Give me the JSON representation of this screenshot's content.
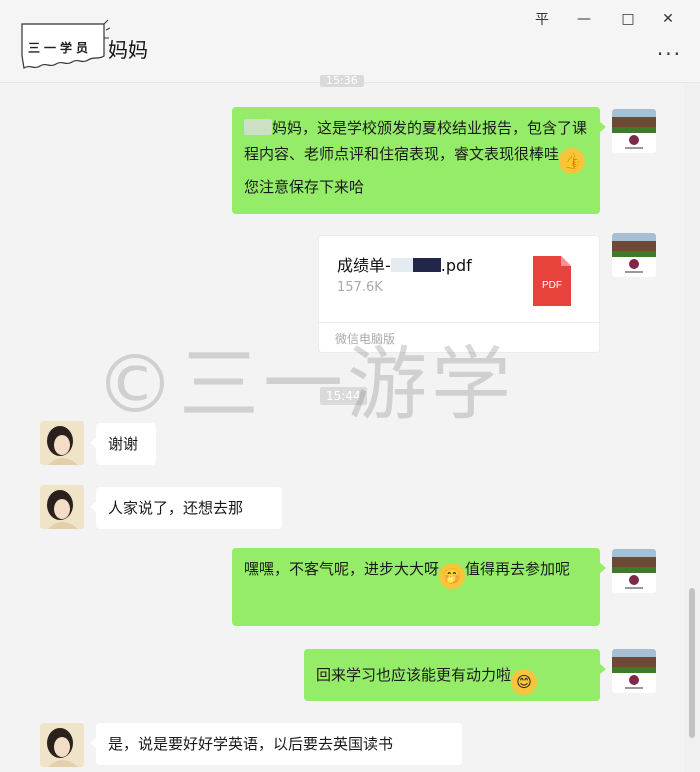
{
  "window": {
    "controls": {
      "pin": "平",
      "minimize": "—",
      "maximize": "□",
      "close": "✕"
    },
    "more": "···"
  },
  "brand": {
    "text": "三一学员"
  },
  "chat": {
    "title": "妈妈"
  },
  "timestamps": {
    "top": "15:36",
    "middle": "15:44"
  },
  "messages": [
    {
      "side": "me",
      "text_main": "妈妈，这是学校颁发的夏校结业报告，包含了课程内容、老师点评和住宿表现，睿文表现很棒哇",
      "emoji": "thumbs-up",
      "text_after": "您注意保存下来哈"
    },
    {
      "side": "me",
      "type": "file"
    },
    {
      "side": "other",
      "text": "谢谢"
    },
    {
      "side": "other",
      "text": "人家说了，还想去那"
    },
    {
      "side": "me",
      "text_before": "嘿嘿，不客气呢，进步大大呀",
      "emoji": "blushing-face",
      "text_after": "值得再去参加呢"
    },
    {
      "side": "me",
      "text": "回来学习也应该能更有动力啦",
      "emoji": "happy-face"
    },
    {
      "side": "other",
      "text": "是，说是要好好学英语，以后要去英国读书"
    }
  ],
  "file": {
    "name_prefix": "成绩单-",
    "name_ext": ".pdf",
    "size": "157.6K",
    "icon_label": "PDF",
    "footer": "微信电脑版"
  },
  "watermark": "©三一游学",
  "colors": {
    "my_bubble": "#95ec69",
    "other_bubble": "#ffffff",
    "pdf_red": "#e8423c"
  }
}
